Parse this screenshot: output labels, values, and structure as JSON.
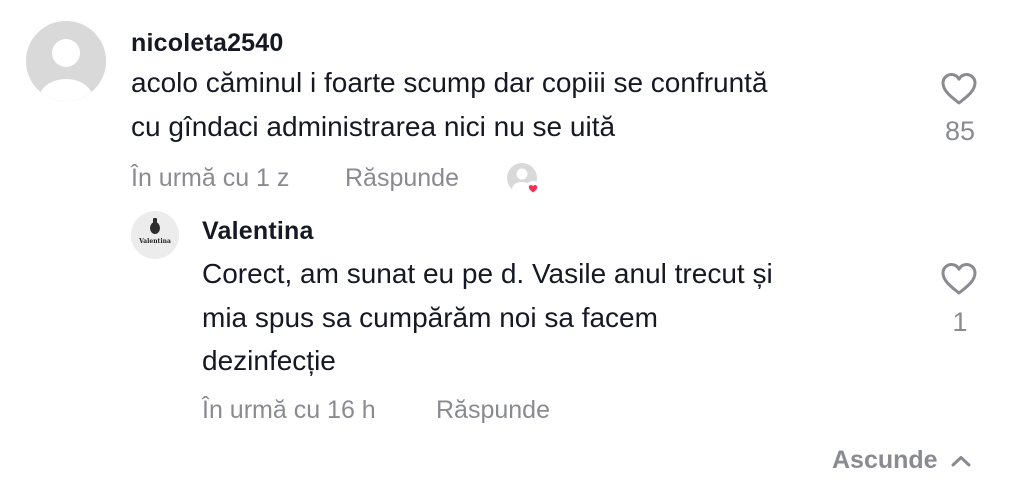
{
  "comments": [
    {
      "username": "nicoleta2540",
      "text_line1": "acolo căminul i foarte scump dar copiii se confruntă",
      "text_line2": "cu gîndaci administrarea nici nu se uită",
      "time": "În urmă cu 1 z",
      "reply_label": "Răspunde",
      "likes": "85",
      "icons": {
        "avatar": "default-avatar-icon",
        "like": "heart-outline-icon",
        "liked_by_creator": "creator-liked-avatar-icon"
      }
    }
  ],
  "replies": [
    {
      "username": "Valentina",
      "avatar_text": "Valentina",
      "text_line1": "Corect, am sunat eu pe d. Vasile anul trecut și",
      "text_line2": "mia spus sa cumpărăm noi sa facem",
      "text_line3": "dezinfecție",
      "time": "În urmă cu 16 h",
      "reply_label": "Răspunde",
      "likes": "1",
      "icons": {
        "like": "heart-outline-icon"
      }
    }
  ],
  "collapse": {
    "label": "Ascunde",
    "icon": "chevron-up-icon"
  },
  "colors": {
    "text": "#161823",
    "muted": "#8a8b91",
    "avatar_bg": "#d9d9d9",
    "badge": "#fe2c55"
  }
}
